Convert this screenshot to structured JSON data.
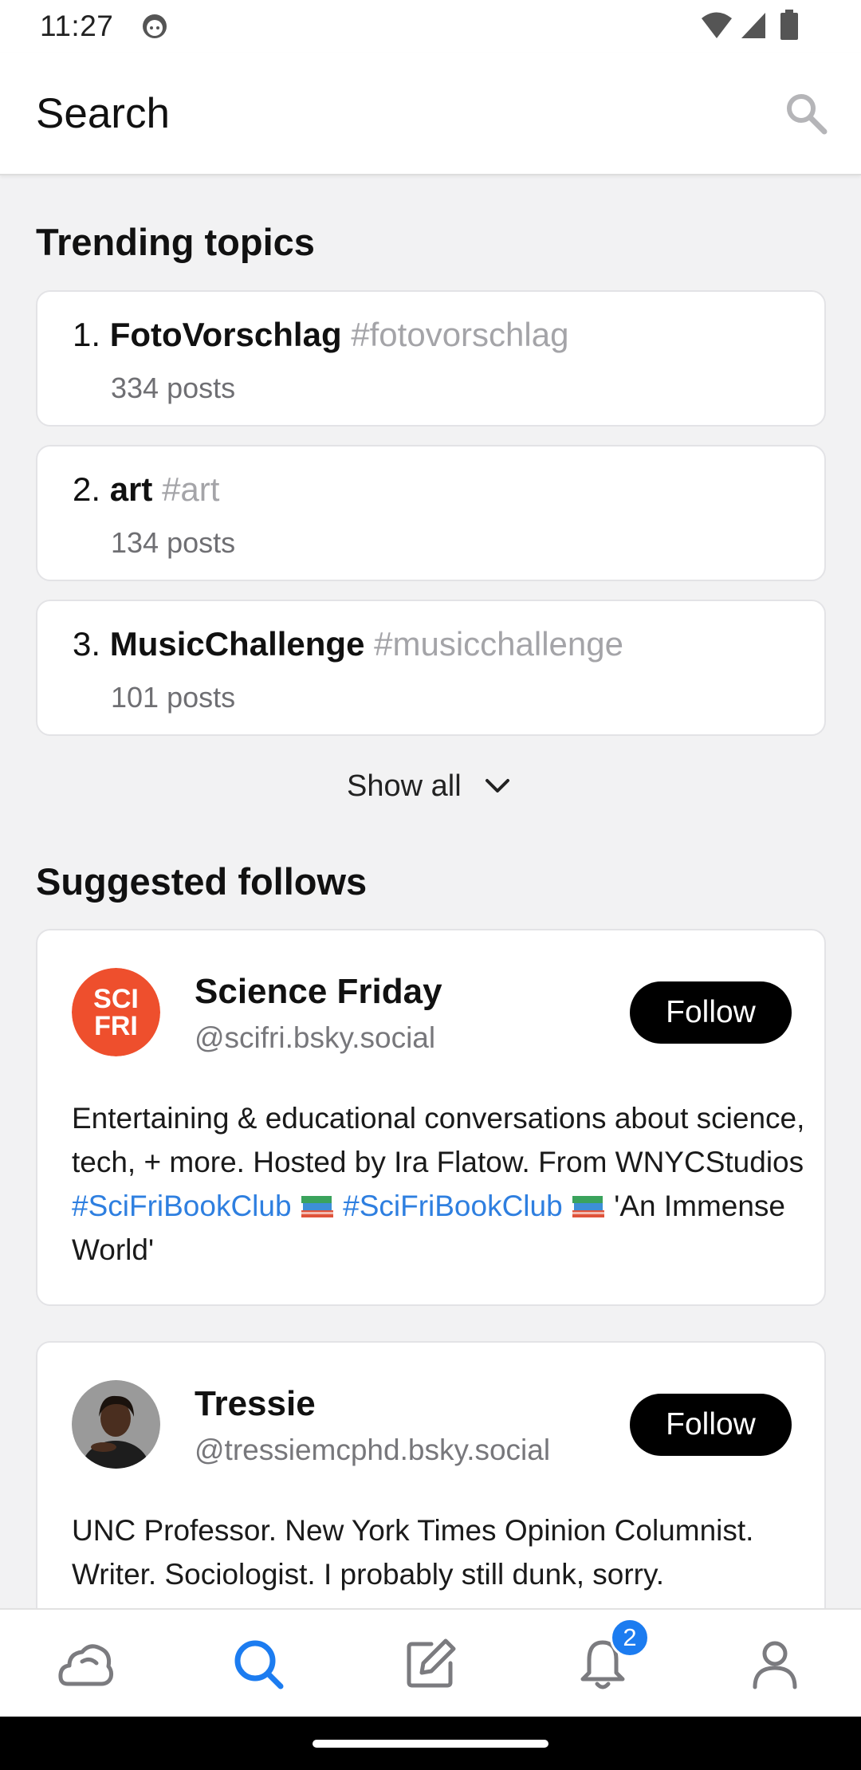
{
  "status_bar": {
    "time": "11:27"
  },
  "header": {
    "title": "Search"
  },
  "trending": {
    "title": "Trending topics",
    "items": [
      {
        "rank": "1.",
        "name": "FotoVorschlag",
        "tag": "#fotovorschlag",
        "count": "334 posts"
      },
      {
        "rank": "2.",
        "name": "art",
        "tag": "#art",
        "count": "134 posts"
      },
      {
        "rank": "3.",
        "name": "MusicChallenge",
        "tag": "#musicchallenge",
        "count": "101 posts"
      }
    ],
    "show_all": "Show all"
  },
  "suggested": {
    "title": "Suggested follows",
    "items": [
      {
        "name": "Science Friday",
        "handle": "@scifri.bsky.social",
        "button": "Follow",
        "avatar_text_top": "SCI",
        "avatar_text_bottom": "FRI",
        "bio": {
          "text1": "Entertaining & educational conversations about science, tech, + more. Hosted by Ira Flatow. From WNYCStudios ",
          "link1": "#SciFriBookClub",
          "link2": "#SciFriBookClub",
          "text2": " 'An Immense World'"
        }
      },
      {
        "name": "Tressie",
        "handle": "@tressiemcphd.bsky.social",
        "button": "Follow",
        "bio": "UNC Professor. New York Times Opinion Columnist. Writer. Sociologist. I probably still dunk, sorry."
      }
    ]
  },
  "bottom_nav": {
    "items": [
      "home-icon",
      "search-icon",
      "compose-icon",
      "notifications-icon",
      "profile-icon"
    ],
    "active": "search-icon",
    "notification_count": "2"
  },
  "colors": {
    "accent": "#1c7cf0",
    "link": "#2e7fe0",
    "scifri": "#ee4f2d",
    "follow_button": "#000000"
  }
}
